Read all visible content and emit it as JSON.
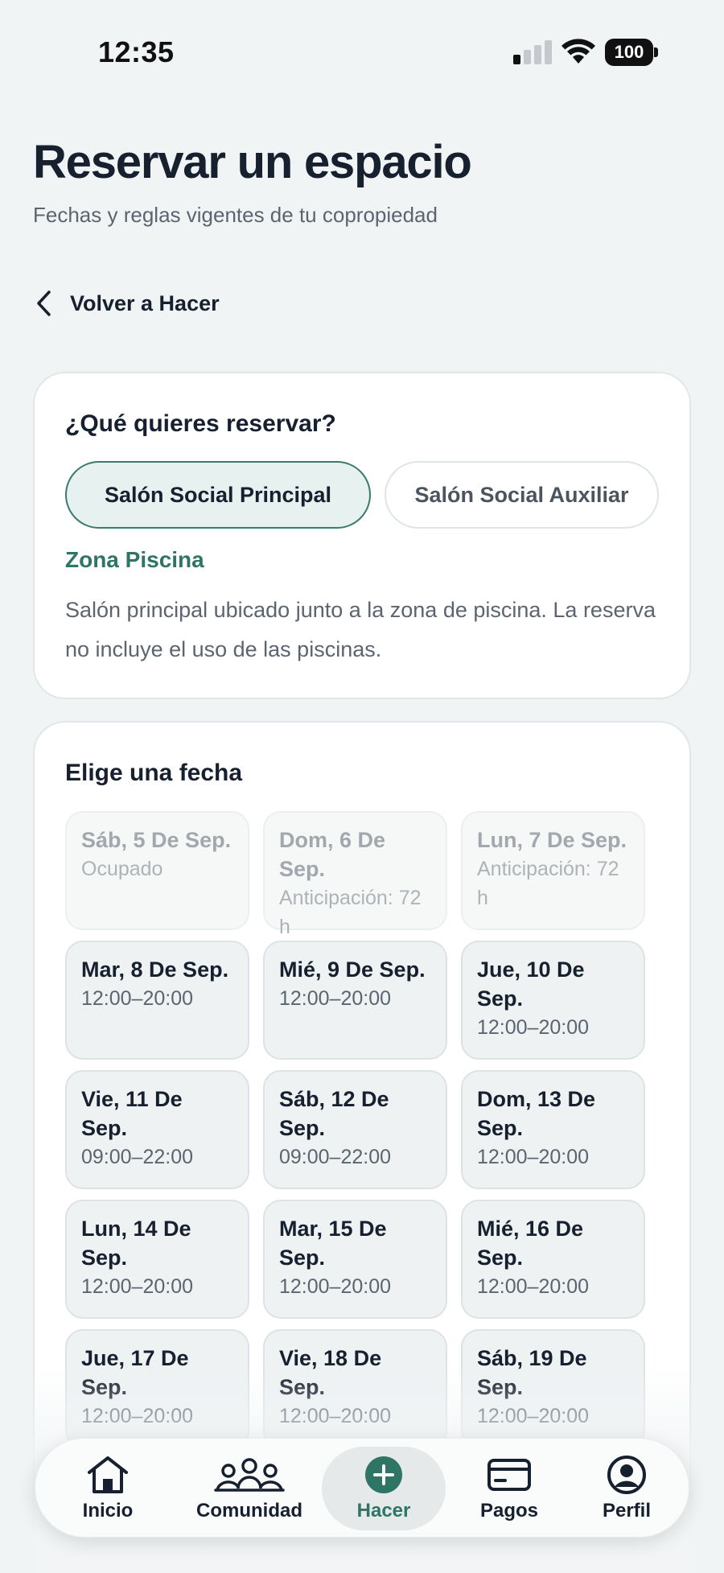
{
  "status_bar": {
    "time": "12:35",
    "battery": "100"
  },
  "header": {
    "title": "Reservar un espacio",
    "subtitle": "Fechas y reglas vigentes de tu copropiedad",
    "back_label": "Volver a Hacer"
  },
  "space_card": {
    "title": "¿Qué quieres reservar?",
    "options": [
      {
        "label": "Salón Social Principal",
        "selected": true
      },
      {
        "label": "Salón Social Auxiliar",
        "selected": false
      }
    ],
    "zone": "Zona Piscina",
    "description": "Salón principal ubicado junto a la zona de piscina. La reserva no incluye el uso de las piscinas."
  },
  "date_card": {
    "title": "Elige una fecha",
    "dates": [
      {
        "day": "Sáb, 5 De Sep.",
        "info": "Ocupado",
        "available": false
      },
      {
        "day": "Dom, 6 De Sep.",
        "info": "Anticipación: 72 h",
        "available": false
      },
      {
        "day": "Lun, 7 De Sep.",
        "info": "Anticipación: 72 h",
        "available": false
      },
      {
        "day": "Mar, 8 De Sep.",
        "info": "12:00–20:00",
        "available": true
      },
      {
        "day": "Mié, 9 De Sep.",
        "info": "12:00–20:00",
        "available": true
      },
      {
        "day": "Jue, 10 De Sep.",
        "info": "12:00–20:00",
        "available": true
      },
      {
        "day": "Vie, 11 De Sep.",
        "info": "09:00–22:00",
        "available": true
      },
      {
        "day": "Sáb, 12 De Sep.",
        "info": "09:00–22:00",
        "available": true
      },
      {
        "day": "Dom, 13 De Sep.",
        "info": "12:00–20:00",
        "available": true
      },
      {
        "day": "Lun, 14 De Sep.",
        "info": "12:00–20:00",
        "available": true
      },
      {
        "day": "Mar, 15 De Sep.",
        "info": "12:00–20:00",
        "available": true
      },
      {
        "day": "Mié, 16 De Sep.",
        "info": "12:00–20:00",
        "available": true
      },
      {
        "day": "Jue, 17 De Sep.",
        "info": "12:00–20:00",
        "available": true
      },
      {
        "day": "Vie, 18 De Sep.",
        "info": "12:00–20:00",
        "available": true
      },
      {
        "day": "Sáb, 19 De Sep.",
        "info": "12:00–20:00",
        "available": true
      }
    ]
  },
  "tab_bar": {
    "active": "Hacer",
    "tabs": [
      {
        "label": "Inicio",
        "icon": "home-icon"
      },
      {
        "label": "Comunidad",
        "icon": "community-icon"
      },
      {
        "label": "Hacer",
        "icon": "plus-circle-icon"
      },
      {
        "label": "Pagos",
        "icon": "card-icon"
      },
      {
        "label": "Perfil",
        "icon": "profile-icon"
      }
    ]
  },
  "colors": {
    "accent": "#2f7565",
    "selected_chip_bg": "#e6f1f0",
    "text_dark": "#16202e",
    "page_bg": "#f1f4f5"
  }
}
